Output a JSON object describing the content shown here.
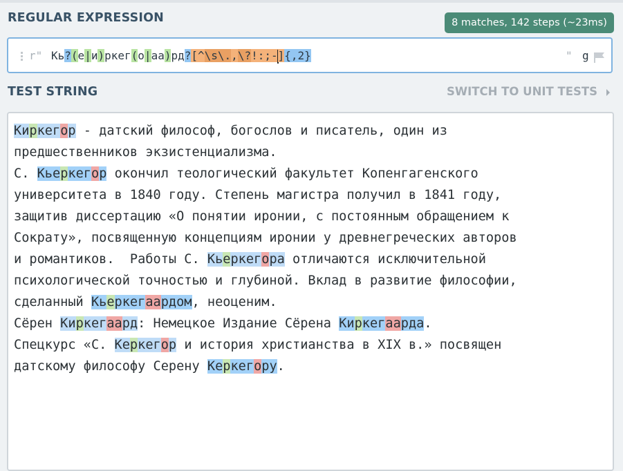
{
  "regex_section": {
    "title": "REGULAR EXPRESSION",
    "match_info": "8 matches, 142 steps (~23ms)",
    "delimiter_open": "r\"",
    "delimiter_close": "\"",
    "flags": "g",
    "pattern": "Кь?(е|и)ркег(о|аа)рд?[^\\s\\.,\\?!:;-]{,2}",
    "pattern_tokens": [
      {
        "text": "Кь",
        "style": "plain"
      },
      {
        "text": "?",
        "style": "blue"
      },
      {
        "text": "(",
        "style": "green"
      },
      {
        "text": "е",
        "style": "plain"
      },
      {
        "text": "|",
        "style": "green"
      },
      {
        "text": "и",
        "style": "plain"
      },
      {
        "text": ")",
        "style": "green"
      },
      {
        "text": "ркег",
        "style": "plain"
      },
      {
        "text": "(",
        "style": "green"
      },
      {
        "text": "о",
        "style": "plain"
      },
      {
        "text": "|",
        "style": "green"
      },
      {
        "text": "аа",
        "style": "plain"
      },
      {
        "text": ")",
        "style": "green"
      },
      {
        "text": "рд",
        "style": "plain"
      },
      {
        "text": "?",
        "style": "blue"
      },
      {
        "text": "[^",
        "style": "orange"
      },
      {
        "text": "\\s",
        "style": "orange2"
      },
      {
        "text": "\\.",
        "style": "orange2"
      },
      {
        "text": ",",
        "style": "orange"
      },
      {
        "text": "\\?",
        "style": "orange2"
      },
      {
        "text": "!:;-",
        "style": "orange"
      },
      {
        "text": "CARET",
        "style": "caret"
      },
      {
        "text": "]",
        "style": "orange"
      },
      {
        "text": "{,2}",
        "style": "blue"
      }
    ],
    "icons": [
      "drag-handle-icon",
      "flag-icon"
    ],
    "colors": {
      "badge": "#4b8b77",
      "quantifier": "#93c6f2",
      "group": "#b9e4a2",
      "char_class": "#f4b27a",
      "match_light": "#bfdcf7",
      "match_dark": "#a2d1f8",
      "group1": "#c9e7b4",
      "group2": "#f0a7a5"
    }
  },
  "test_section": {
    "title": "TEST STRING",
    "switch_label": "SWITCH TO UNIT TESTS",
    "lines": [
      [
        {
          "t": "Ки",
          "c": "m1"
        },
        {
          "t": "р",
          "c": "g"
        },
        {
          "t": "кег",
          "c": "m1"
        },
        {
          "t": "о",
          "c": "r"
        },
        {
          "t": "р",
          "c": "m1"
        },
        {
          "t": " - датский философ, богослов и писатель, один из",
          "c": ""
        }
      ],
      [
        {
          "t": "предшественников экзистенциализма.",
          "c": ""
        }
      ],
      [
        {
          "t": "С. ",
          "c": ""
        },
        {
          "t": "Кье",
          "c": "m2"
        },
        {
          "t": "р",
          "c": "g"
        },
        {
          "t": "кег",
          "c": "m2"
        },
        {
          "t": "о",
          "c": "r"
        },
        {
          "t": "р",
          "c": "m2"
        },
        {
          "t": " окончил теологический факультет Копенгагенского",
          "c": ""
        }
      ],
      [
        {
          "t": "университета в 1840 году. Степень магистра получил в 1841 году,",
          "c": ""
        }
      ],
      [
        {
          "t": "защитив диссертацию «О понятии иронии, с постоянным обращением к",
          "c": ""
        }
      ],
      [
        {
          "t": "Сократу», посвященную концепциям иронии у древнегреческих авторов",
          "c": ""
        }
      ],
      [
        {
          "t": "и романтиков.  Работы С. ",
          "c": ""
        },
        {
          "t": "Кь",
          "c": "m1"
        },
        {
          "t": "е",
          "c": "g"
        },
        {
          "t": "ркег",
          "c": "m1"
        },
        {
          "t": "о",
          "c": "r"
        },
        {
          "t": "ра",
          "c": "m1"
        },
        {
          "t": " отличаются исключительной",
          "c": ""
        }
      ],
      [
        {
          "t": "психологической точностью и глубиной. Вклад в развитие философии,",
          "c": ""
        }
      ],
      [
        {
          "t": "сделанный ",
          "c": ""
        },
        {
          "t": "Кь",
          "c": "m2"
        },
        {
          "t": "е",
          "c": "g"
        },
        {
          "t": "ркег",
          "c": "m2"
        },
        {
          "t": "аа",
          "c": "r"
        },
        {
          "t": "рдом",
          "c": "m2"
        },
        {
          "t": ", неоценим.",
          "c": ""
        }
      ],
      [
        {
          "t": "Сёрен ",
          "c": ""
        },
        {
          "t": "Ки",
          "c": "m1"
        },
        {
          "t": "р",
          "c": "g"
        },
        {
          "t": "кег",
          "c": "m1"
        },
        {
          "t": "аа",
          "c": "r"
        },
        {
          "t": "рд",
          "c": "m1"
        },
        {
          "t": ": Немецкое Издание Сёрена ",
          "c": ""
        },
        {
          "t": "Ки",
          "c": "m2"
        },
        {
          "t": "р",
          "c": "g"
        },
        {
          "t": "кег",
          "c": "m2"
        },
        {
          "t": "аа",
          "c": "r"
        },
        {
          "t": "рда",
          "c": "m2"
        },
        {
          "t": ".",
          "c": ""
        }
      ],
      [
        {
          "t": "Спецкурс «С. ",
          "c": ""
        },
        {
          "t": "Ке",
          "c": "m1"
        },
        {
          "t": "р",
          "c": "g"
        },
        {
          "t": "кег",
          "c": "m1"
        },
        {
          "t": "о",
          "c": "r"
        },
        {
          "t": "р",
          "c": "m1"
        },
        {
          "t": " и история христианства в XIX в.» посвящен",
          "c": ""
        }
      ],
      [
        {
          "t": "датскому философу Серену ",
          "c": ""
        },
        {
          "t": "Ке",
          "c": "m2"
        },
        {
          "t": "р",
          "c": "g"
        },
        {
          "t": "кег",
          "c": "m2"
        },
        {
          "t": "о",
          "c": "r"
        },
        {
          "t": "ру",
          "c": "m2"
        },
        {
          "t": ".",
          "c": ""
        }
      ]
    ]
  }
}
